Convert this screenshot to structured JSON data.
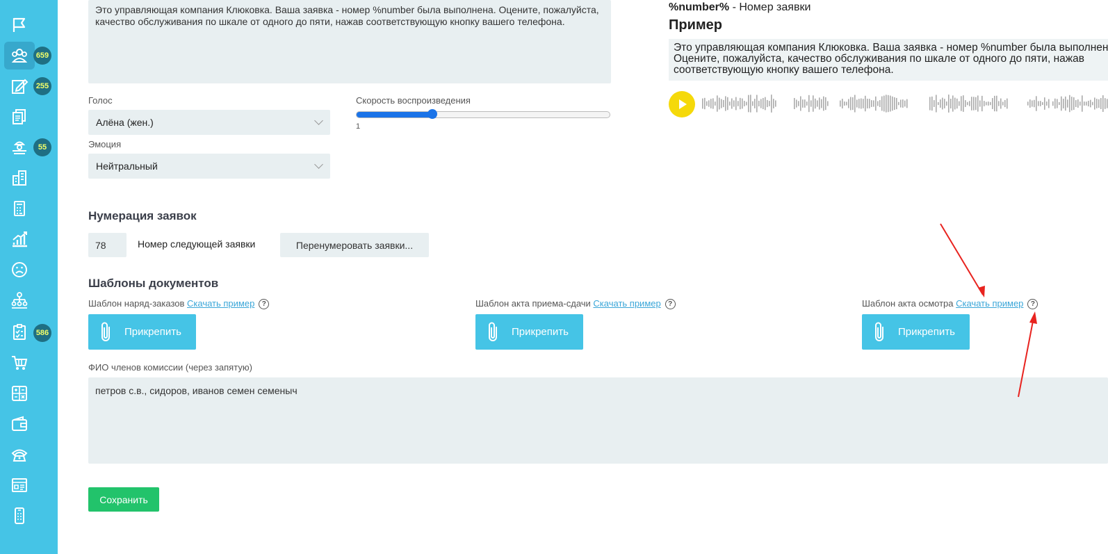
{
  "sidebar": {
    "items": [
      {
        "icon": "flag-icon",
        "badge": ""
      },
      {
        "icon": "users-icon",
        "badge": "659",
        "active": true
      },
      {
        "icon": "edit-icon",
        "badge": "255"
      },
      {
        "icon": "documents-icon",
        "badge": ""
      },
      {
        "icon": "worker-icon",
        "badge": "55"
      },
      {
        "icon": "building-icon",
        "badge": ""
      },
      {
        "icon": "calculator-icon",
        "badge": ""
      },
      {
        "icon": "chart-growth-icon",
        "badge": ""
      },
      {
        "icon": "sad-face-icon",
        "badge": ""
      },
      {
        "icon": "org-structure-icon",
        "badge": ""
      },
      {
        "icon": "clipboard-check-icon",
        "badge": "586"
      },
      {
        "icon": "cart-icon",
        "badge": ""
      },
      {
        "icon": "calc-grid-icon",
        "badge": ""
      },
      {
        "icon": "wallet-icon",
        "badge": ""
      },
      {
        "icon": "phone-icon",
        "badge": ""
      },
      {
        "icon": "window-icon",
        "badge": ""
      },
      {
        "icon": "mobile-icon",
        "badge": ""
      }
    ]
  },
  "message_text": "Это управляющая компания Клюковка. Ваша заявка - номер %number была выполнена. Оцените, пожалуйста, качество обслуживания по шкале от одного до пяти, нажав соответствующую кнопку вашего телефона.",
  "voice": {
    "label": "Голос",
    "value": "Алёна (жен.)"
  },
  "emotion": {
    "label": "Эмоция",
    "value": "Нейтральный"
  },
  "speed": {
    "label": "Скорость воспроизведения",
    "value": "1",
    "fraction": 0.3
  },
  "preview": {
    "variable": "%number%",
    "variable_desc": " - Номер заявки",
    "title": "Пример",
    "text": "Это управляющая компания Клюковка. Ваша заявка - номер %number была выполнена. Оцените, пожалуйста, качество обслуживания по шкале от одного до пяти, нажав соответствующую кнопку вашего телефона."
  },
  "numbering": {
    "title": "Нумерация заявок",
    "value": "78",
    "label": "Номер следующей заявки",
    "button": "Перенумеровать заявки..."
  },
  "templates": {
    "title": "Шаблоны документов",
    "items": [
      {
        "label": "Шаблон наряд-заказов",
        "link": "Скачать пример",
        "button": "Прикрепить"
      },
      {
        "label": "Шаблон акта приема-сдачи",
        "link": "Скачать пример",
        "button": "Прикрепить"
      },
      {
        "label": "Шаблон акта осмотра",
        "link": "Скачать пример",
        "button": "Прикрепить"
      }
    ],
    "help_glyph": "?"
  },
  "commission": {
    "label": "ФИО членов комиссии (через запятую)",
    "value": "петров с.в., сидоров, иванов семен семеныч"
  },
  "save_label": "Сохранить",
  "colors": {
    "accent": "#45c4e6",
    "save": "#22c36b",
    "play": "#f5d90a",
    "annotation": "#e8231f"
  }
}
